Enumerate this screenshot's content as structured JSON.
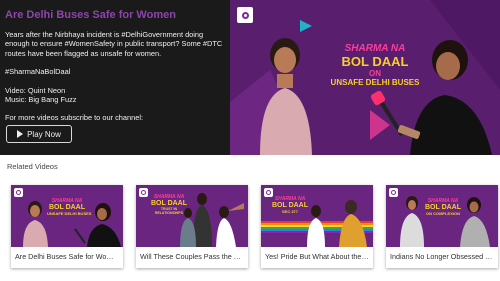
{
  "hero": {
    "title": "Are Delhi Buses Safe for Women",
    "desc_1": "Years after the Nirbhaya incident is #DelhiGovernment doing enough to ensure #WomenSafety in public transport? Some #DTC routes have been flagged as unsafe for women.",
    "desc_2": "#SharmaNaBolDaal",
    "video_credit": "Video: Quint Neon",
    "music_credit": "Music: Big Bang Fuzz",
    "desc_3": "For more videos subscribe to our channel:",
    "play_label": "Play Now",
    "thumb": {
      "show_line1": "SHARMA NA",
      "show_line2": "BOL DAAL",
      "subtitle_line1": "ON",
      "subtitle_line2": "UNSAFE DELHI BUSES"
    }
  },
  "related": {
    "label": "Related Videos",
    "cards": [
      {
        "caption": "Are Delhi Buses Safe for Women",
        "thumb_top": "SHARMA NA",
        "thumb_mid": "BOL DAAL",
        "thumb_sub": "UNSAFE DELHI BUSES"
      },
      {
        "caption": "Will These Couples Pass the Trust Test?",
        "thumb_top": "SHARMA NA",
        "thumb_mid": "BOL DAAL",
        "thumb_sub": "TRUST IN RELATIONSHIPS"
      },
      {
        "caption": "Yes! Pride But What About the Law?",
        "thumb_top": "SHARMA NA",
        "thumb_mid": "BOL DAAL",
        "thumb_sub": "SEC 377"
      },
      {
        "caption": "Indians No Longer Obsessed With Fair Skin?",
        "thumb_top": "SHARMA NA",
        "thumb_mid": "BOL DAAL",
        "thumb_sub": "ON COMPLEXION"
      }
    ]
  },
  "colors": {
    "title_purple": "#8e44ad",
    "thumb_purple": "#5a1e6e",
    "accent_pink": "#ff3c9a",
    "accent_yellow": "#f6d02a"
  }
}
